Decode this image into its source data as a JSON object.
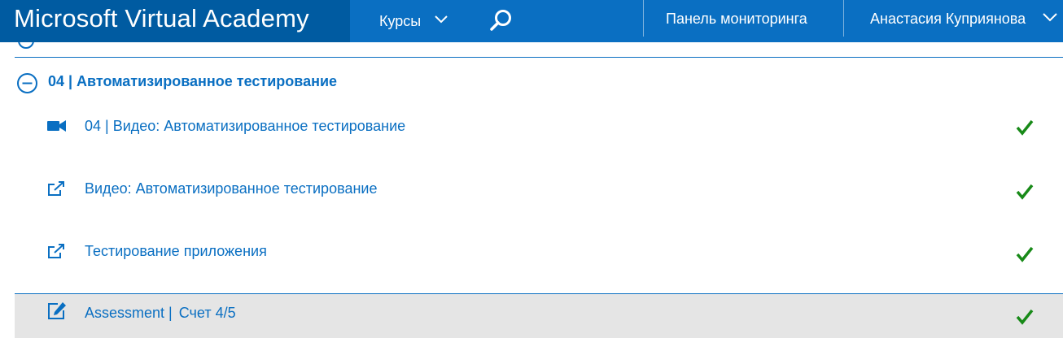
{
  "header": {
    "brand": "Microsoft Virtual Academy",
    "courses_label": "Курсы",
    "dashboard_label": "Панель мониторинга",
    "user_name": "Анастасия Куприянова"
  },
  "section": {
    "title": "04 | Автоматизированное тестирование",
    "items": [
      {
        "label": "04 | Видео: Автоматизированное тестирование",
        "icon": "video-camera-icon",
        "status": "completed"
      },
      {
        "label": "Видео: Автоматизированное тестирование",
        "icon": "external-link-icon",
        "status": "completed"
      },
      {
        "label": "Тестирование приложения",
        "icon": "external-link-icon",
        "status": "completed"
      },
      {
        "label": "Assessment",
        "score": "Счет 4/5",
        "icon": "edit-assessment-icon",
        "status": "completed"
      }
    ]
  },
  "colors": {
    "header_bg": "#0a6fc2",
    "brand_bg": "#005ba1",
    "link": "#0a6fc2",
    "check": "#188a18",
    "active_row_bg": "#e5e5e5"
  }
}
